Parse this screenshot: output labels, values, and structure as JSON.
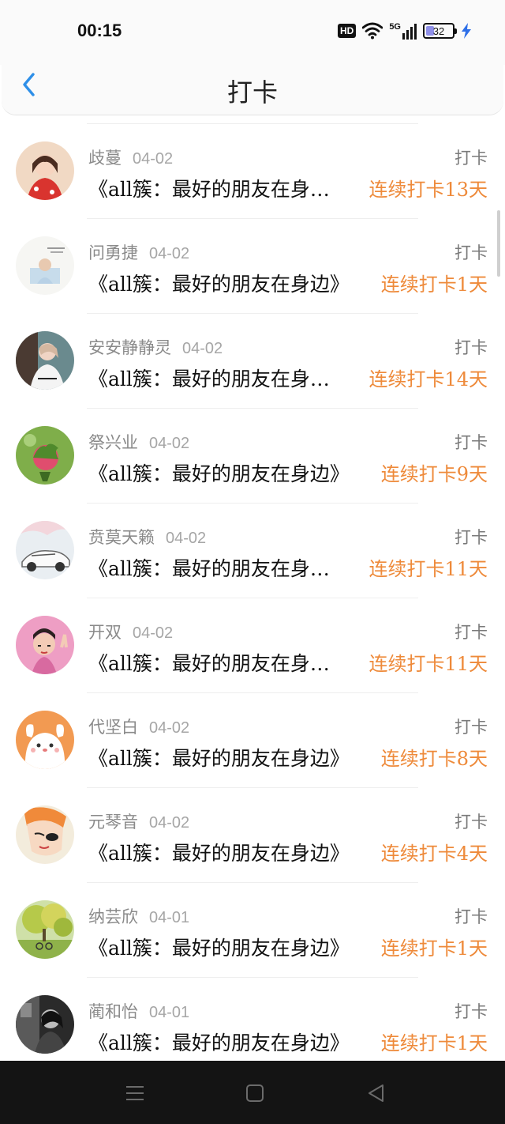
{
  "status_bar": {
    "time": "00:15",
    "hd": "HD",
    "network": "5G",
    "battery": "32",
    "battery_level": 0.32
  },
  "header": {
    "title": "打卡",
    "back_icon": "chevron-left-icon",
    "accent_color": "#2e8fe8"
  },
  "checkins": [
    {
      "name": "歧蔓",
      "date": "04-02",
      "action": "打卡",
      "book": "《all簇：最好的朋友在身…",
      "streak": "连续打卡13天"
    },
    {
      "name": "问勇捷",
      "date": "04-02",
      "action": "打卡",
      "book": "《all簇：最好的朋友在身边》",
      "streak": "连续打卡1天"
    },
    {
      "name": "安安静静灵",
      "date": "04-02",
      "action": "打卡",
      "book": "《all簇：最好的朋友在身…",
      "streak": "连续打卡14天"
    },
    {
      "name": "祭兴业",
      "date": "04-02",
      "action": "打卡",
      "book": "《all簇：最好的朋友在身边》",
      "streak": "连续打卡9天"
    },
    {
      "name": "贲莫天籁",
      "date": "04-02",
      "action": "打卡",
      "book": "《all簇：最好的朋友在身…",
      "streak": "连续打卡11天"
    },
    {
      "name": "开双",
      "date": "04-02",
      "action": "打卡",
      "book": "《all簇：最好的朋友在身…",
      "streak": "连续打卡11天"
    },
    {
      "name": "代坚白",
      "date": "04-02",
      "action": "打卡",
      "book": "《all簇：最好的朋友在身边》",
      "streak": "连续打卡8天"
    },
    {
      "name": "元琴音",
      "date": "04-02",
      "action": "打卡",
      "book": "《all簇：最好的朋友在身边》",
      "streak": "连续打卡4天"
    },
    {
      "name": "纳芸欣",
      "date": "04-01",
      "action": "打卡",
      "book": "《all簇：最好的朋友在身边》",
      "streak": "连续打卡1天"
    },
    {
      "name": "蔺和怡",
      "date": "04-01",
      "action": "打卡",
      "book": "《all簇：最好的朋友在身边》",
      "streak": "连续打卡1天"
    }
  ],
  "colors": {
    "streak": "#ee8a3a",
    "name": "#8a8a8a",
    "title": "#111111",
    "nav_bar": "#141414"
  },
  "nav": {
    "icons": [
      "menu-icon",
      "home-square-icon",
      "back-triangle-icon"
    ]
  }
}
